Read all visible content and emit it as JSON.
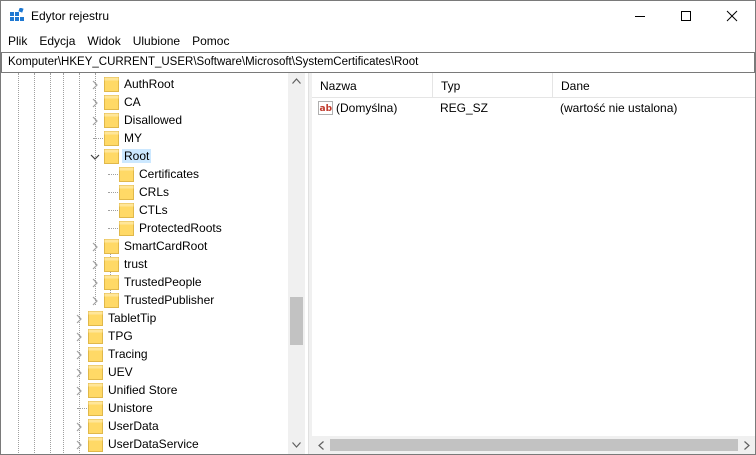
{
  "window": {
    "title": "Edytor rejestru"
  },
  "menu": [
    "Plik",
    "Edycja",
    "Widok",
    "Ulubione",
    "Pomoc"
  ],
  "address": {
    "path": "Komputer\\HKEY_CURRENT_USER\\Software\\Microsoft\\SystemCertificates\\Root"
  },
  "tree": {
    "items": [
      {
        "label": "AuthRoot",
        "expandable": true
      },
      {
        "label": "CA",
        "expandable": true
      },
      {
        "label": "Disallowed",
        "expandable": true
      },
      {
        "label": "MY",
        "expandable": false
      },
      {
        "label": "Root",
        "expandable": true,
        "expanded": true,
        "selected": true
      },
      {
        "label": "Certificates",
        "expandable": false
      },
      {
        "label": "CRLs",
        "expandable": false
      },
      {
        "label": "CTLs",
        "expandable": false
      },
      {
        "label": "ProtectedRoots",
        "expandable": false
      },
      {
        "label": "SmartCardRoot",
        "expandable": true
      },
      {
        "label": "trust",
        "expandable": true
      },
      {
        "label": "TrustedPeople",
        "expandable": true
      },
      {
        "label": "TrustedPublisher",
        "expandable": true
      },
      {
        "label": "TabletTip",
        "expandable": true
      },
      {
        "label": "TPG",
        "expandable": true
      },
      {
        "label": "Tracing",
        "expandable": true
      },
      {
        "label": "UEV",
        "expandable": true
      },
      {
        "label": "Unified Store",
        "expandable": true
      },
      {
        "label": "Unistore",
        "expandable": false
      },
      {
        "label": "UserData",
        "expandable": true
      },
      {
        "label": "UserDataService",
        "expandable": true
      }
    ]
  },
  "list": {
    "columns": {
      "name": "Nazwa",
      "type": "Typ",
      "data": "Dane"
    },
    "rows": [
      {
        "name": "(Domyślna)",
        "type": "REG_SZ",
        "data": "(wartość nie ustalona)",
        "icon": "string-value-icon"
      }
    ]
  },
  "colors": {
    "selection": "#cce8ff",
    "folder": "#ffd966",
    "accent": "#0078d7"
  }
}
